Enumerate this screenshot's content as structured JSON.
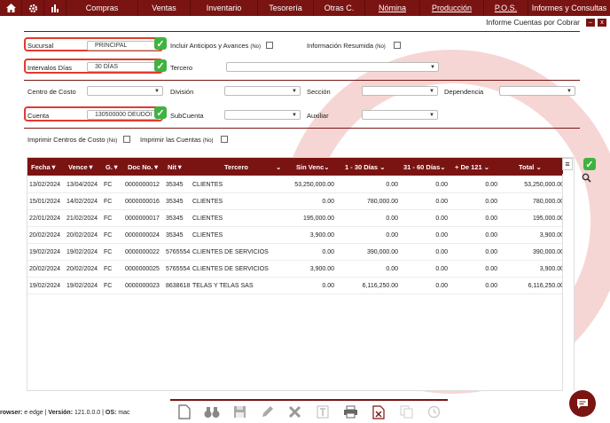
{
  "nav": {
    "items": [
      {
        "label": "Compras",
        "underline": false
      },
      {
        "label": "Ventas",
        "underline": false
      },
      {
        "label": "Inventario",
        "underline": false
      },
      {
        "label": "Tesorería",
        "underline": false
      },
      {
        "label": "Otras C.",
        "underline": false
      },
      {
        "label": "Nómina",
        "underline": true
      },
      {
        "label": "Producción",
        "underline": true
      },
      {
        "label": "P.O.S.",
        "underline": true
      },
      {
        "label": "Informes y Consultas",
        "underline": false
      }
    ],
    "icons": [
      "home-icon",
      "settings-icon",
      "chart-icon"
    ]
  },
  "window": {
    "title": "Informe Cuentas por Cobrar",
    "minimize": "–",
    "close": "x"
  },
  "filters": {
    "sucursal_label": "Sucursal",
    "sucursal_value": "PRINCIPAL",
    "anticipos_label": "Incluir Anticipos y Avances",
    "anticipos_suffix": "(No)",
    "resumida_label": "Información Resumida",
    "resumida_suffix": "(No)",
    "intervalos_label": "Intervalos Días",
    "intervalos_value": "30 DÍAS",
    "tercero_label": "Tercero",
    "centro_label": "Centro de Costo",
    "division_label": "División",
    "seccion_label": "Sección",
    "dependencia_label": "Dependencia",
    "cuenta_label": "Cuenta",
    "cuenta_value": "130500000 DEUDOI",
    "subcuenta_label": "SubCuenta",
    "auxiliar_label": "Auxiliar",
    "imprimir_centros_label": "Imprimir Centros de Costo",
    "imprimir_centros_suffix": "(No)",
    "imprimir_cuentas_label": "Imprimir las Cuentas",
    "imprimir_cuentas_suffix": "(No)"
  },
  "table": {
    "headers": [
      "Fecha",
      "Vence",
      "G.",
      "Doc No.",
      "Nit",
      "Tercero",
      "Sin Venc",
      "1 - 30 Días",
      "31 - 60 Días",
      "+ De 121",
      "Total"
    ],
    "rows": [
      [
        "13/02/2024",
        "13/04/2024",
        "FC",
        "0000000012",
        "35345",
        "CLIENTES",
        "53,250,000.00",
        "0.00",
        "0.00",
        "0.00",
        "53,250,000.00"
      ],
      [
        "15/01/2024",
        "14/02/2024",
        "FC",
        "0000000016",
        "35345",
        "CLIENTES",
        "0.00",
        "780,000.00",
        "0.00",
        "0.00",
        "780,000.00"
      ],
      [
        "22/01/2024",
        "21/02/2024",
        "FC",
        "0000000017",
        "35345",
        "CLIENTES",
        "195,000.00",
        "0.00",
        "0.00",
        "0.00",
        "195,000.00"
      ],
      [
        "20/02/2024",
        "20/02/2024",
        "FC",
        "0000000024",
        "35345",
        "CLIENTES",
        "3,900.00",
        "0.00",
        "0.00",
        "0.00",
        "3,900.00"
      ],
      [
        "19/02/2024",
        "19/02/2024",
        "FC",
        "0000000022",
        "5765554",
        "CLIENTES DE SERVICIOS",
        "0.00",
        "390,000.00",
        "0.00",
        "0.00",
        "390,000.00"
      ],
      [
        "20/02/2024",
        "20/02/2024",
        "FC",
        "0000000025",
        "5765554",
        "CLIENTES DE SERVICIOS",
        "3,900.00",
        "0.00",
        "0.00",
        "0.00",
        "3,900.00"
      ],
      [
        "19/02/2024",
        "19/02/2024",
        "FC",
        "0000000023",
        "8638618",
        "TELAS Y TELAS SAS",
        "0.00",
        "6,116,250.00",
        "0.00",
        "0.00",
        "6,116,250.00"
      ]
    ]
  },
  "footer": {
    "browser_label": "rowser:",
    "browser_value": "edge",
    "version_label": "Versión:",
    "version_value": "121.0.0.0",
    "os_label": "OS:",
    "os_value": "mac"
  },
  "toolbar_icons": [
    "new-document-icon",
    "binoculars-icon",
    "save-icon",
    "edit-icon",
    "delete-icon",
    "text-icon",
    "print-icon",
    "excel-icon",
    "copy-icon",
    "history-icon"
  ],
  "colors": {
    "brand": "#7a1412",
    "highlight": "#e03c2e",
    "ok": "#3fb33f"
  }
}
